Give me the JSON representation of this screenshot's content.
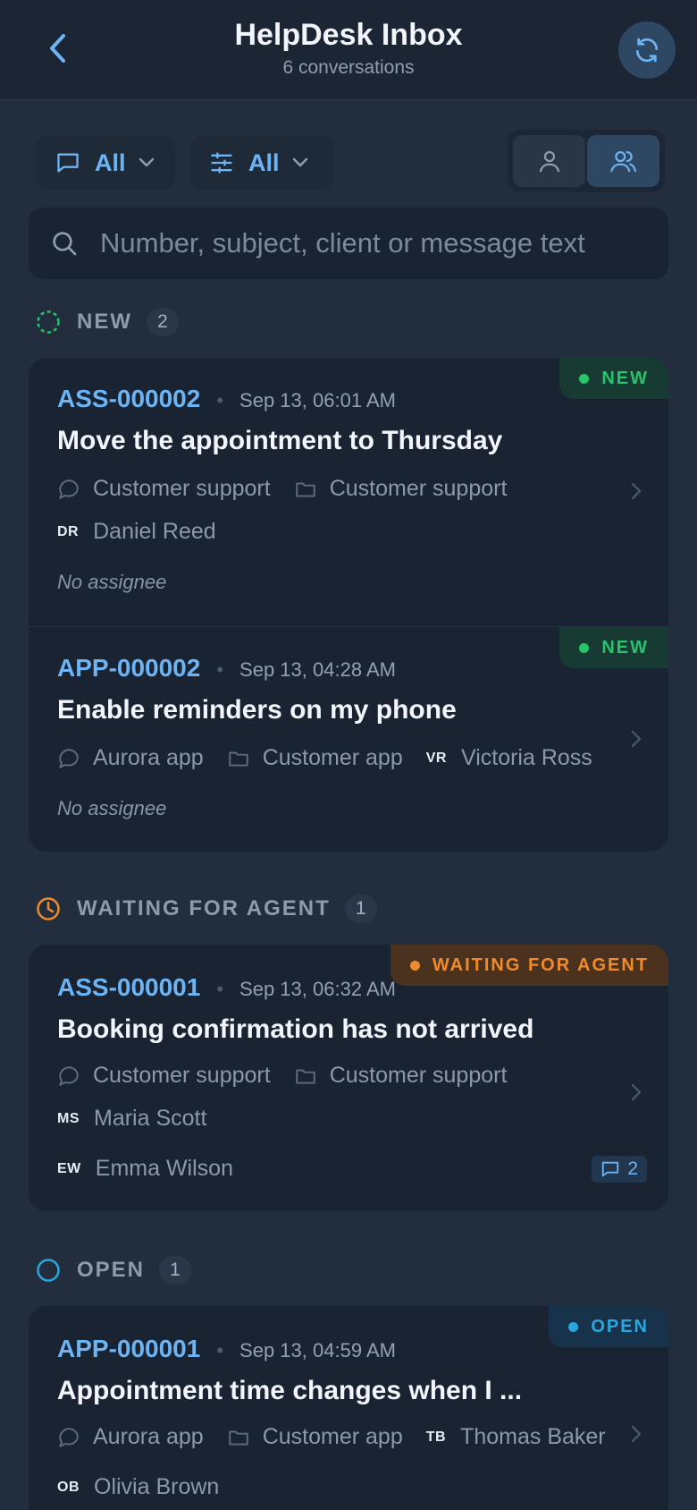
{
  "header": {
    "title": "HelpDesk Inbox",
    "subtitle": "6 conversations"
  },
  "filters": {
    "channel_label": "All",
    "status_label": "All"
  },
  "search": {
    "placeholder": "Number, subject, client or message text"
  },
  "sections": {
    "new": {
      "name": "NEW",
      "count": "2"
    },
    "waiting": {
      "name": "WAITING FOR AGENT",
      "count": "1"
    },
    "open": {
      "name": "OPEN",
      "count": "1"
    }
  },
  "tickets": [
    {
      "id": "ASS-000002",
      "date": "Sep 13, 06:01 AM",
      "subject": "Move the appointment to Thursday",
      "channel": "Customer support",
      "project": "Customer support",
      "client_initials": "DR",
      "client": "Daniel Reed",
      "assignee": "No assignee",
      "badge": "NEW"
    },
    {
      "id": "APP-000002",
      "date": "Sep 13, 04:28 AM",
      "subject": "Enable reminders on my phone",
      "channel": "Aurora app",
      "project": "Customer app",
      "client_initials": "VR",
      "client": "Victoria Ross",
      "assignee": "No assignee",
      "badge": "NEW"
    },
    {
      "id": "ASS-000001",
      "date": "Sep 13, 06:32 AM",
      "subject": "Booking confirmation has not arrived",
      "channel": "Customer support",
      "project": "Customer support",
      "client_initials": "MS",
      "client": "Maria Scott",
      "assignee_initials": "EW",
      "assignee": "Emma Wilson",
      "messages": "2",
      "badge": "WAITING FOR AGENT"
    },
    {
      "id": "APP-000001",
      "date": "Sep 13, 04:59 AM",
      "subject": "Appointment time changes when I ...",
      "channel": "Aurora app",
      "project": "Customer app",
      "client_initials": "TB",
      "client": "Thomas Baker",
      "assignee_initials": "OB",
      "assignee": "Olivia Brown",
      "badge": "OPEN"
    }
  ],
  "colors": {
    "accent": "#6cb4f4",
    "new": "#28c46a",
    "waiting": "#f08b2d",
    "open": "#2aa7e0"
  }
}
